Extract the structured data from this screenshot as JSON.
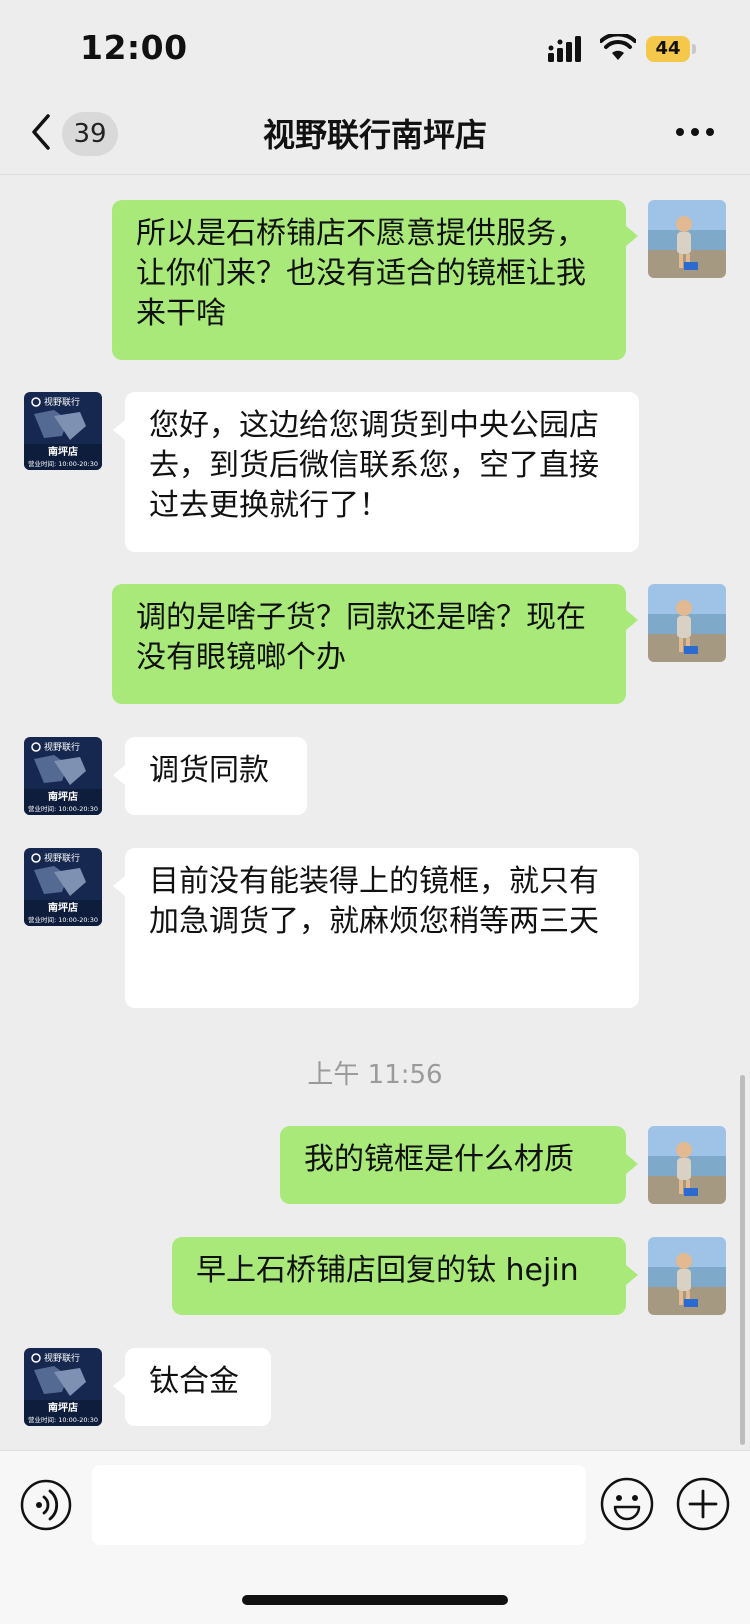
{
  "status_bar": {
    "time": "12:00",
    "battery": "44"
  },
  "header": {
    "unread_count": "39",
    "title": "视野联行南坪店"
  },
  "store_avatar": {
    "brand": "视野联行",
    "store": "南坪店",
    "hours": "营业时间: 10:00-20:30"
  },
  "messages": [
    {
      "sender": "me",
      "text": "所以是石桥铺店不愿意提供服务，让你们来？也没有适合的镜框让我来干啥"
    },
    {
      "sender": "store",
      "text": "您好，这边给您调货到中央公园店去，到货后微信联系您，空了直接过去更换就行了！"
    },
    {
      "sender": "me",
      "text": "调的是啥子货？同款还是啥？现在没有眼镜啷个办"
    },
    {
      "sender": "store",
      "text": "调货同款"
    },
    {
      "sender": "store",
      "text": "目前没有能装得上的镜框，就只有加急调货了，就麻烦您稍等两三天"
    },
    {
      "sender": "me",
      "text": "我的镜框是什么材质"
    },
    {
      "sender": "me",
      "text": "早上石桥铺店回复的钛 hejin"
    },
    {
      "sender": "store",
      "text": "钛合金"
    }
  ],
  "timestamp": "上午 11:56",
  "colors": {
    "my_bubble": "#a9e97a",
    "other_bubble": "#ffffff",
    "background": "#ededed"
  },
  "icons": [
    "back-icon",
    "more-icon",
    "voice-icon",
    "emoji-icon",
    "plus-icon"
  ]
}
